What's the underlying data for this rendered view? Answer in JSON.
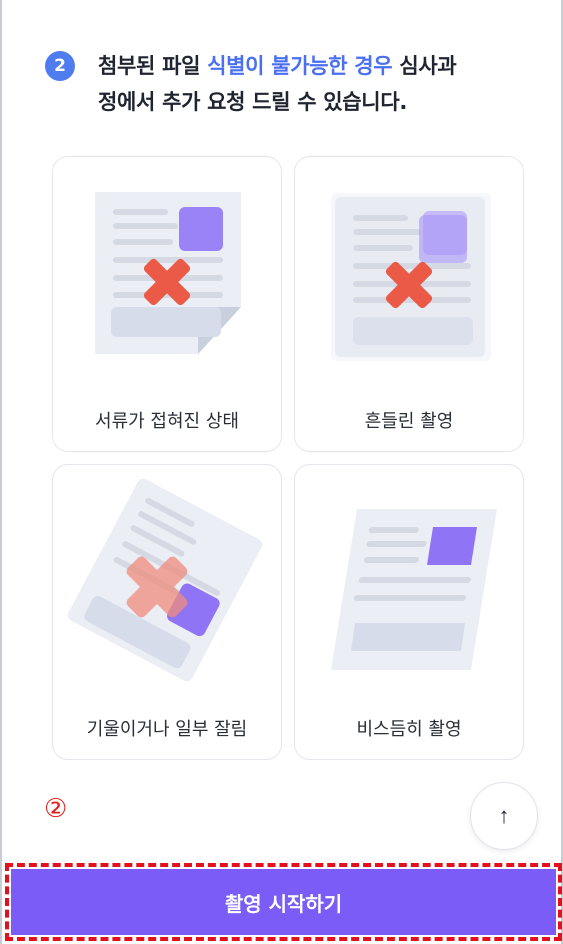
{
  "notice": {
    "step_number": "2",
    "line1_pre": "첨부된 파일 ",
    "line1_highlight": "식별이 불가능한 경우",
    "line1_post": " 심사과",
    "line2": "정에서 추가 요청 드릴 수 있습니다."
  },
  "cards": [
    {
      "caption": "서류가 접혀진 상태",
      "icon": "folded-document-icon"
    },
    {
      "caption": "흔들린 촬영",
      "icon": "blurry-document-icon"
    },
    {
      "caption": "기울이거나 일부 잘림",
      "icon": "tilted-cropped-document-icon"
    },
    {
      "caption": "비스듬히 촬영",
      "icon": "skewed-document-icon"
    }
  ],
  "annotation_marker": "②",
  "scroll_top_icon": "↑",
  "cta": {
    "label": "촬영 시작하기"
  },
  "colors": {
    "accent": "#7b5cf6",
    "step_badge": "#4f7df0",
    "highlight_text": "#4a6ff0",
    "error_x": "#ea5a47",
    "annotation_red": "#e3111e"
  }
}
